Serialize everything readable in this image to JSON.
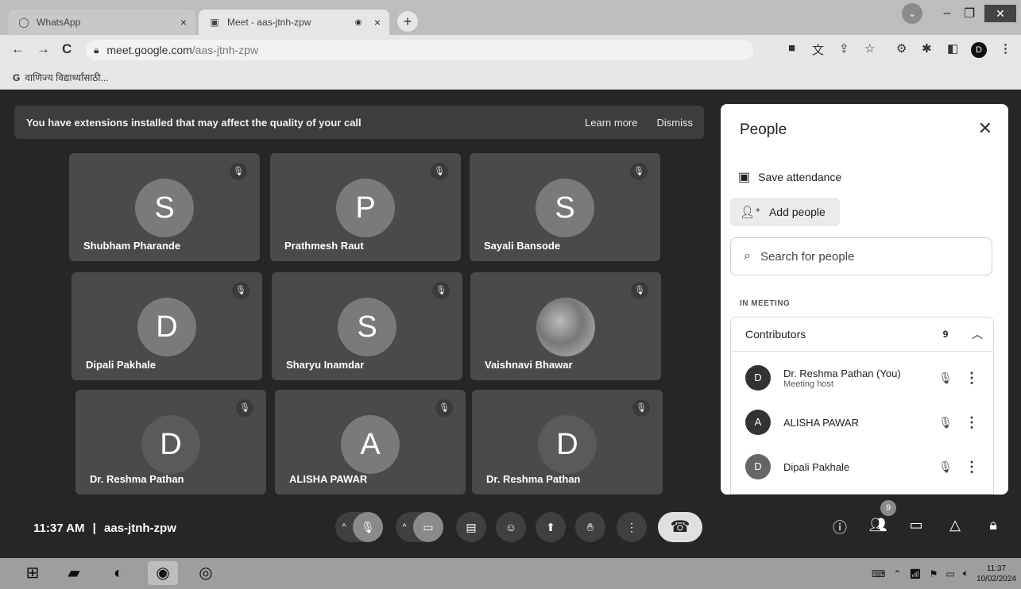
{
  "browser": {
    "tabs": [
      {
        "title": "WhatsApp",
        "icon": "whatsapp-icon",
        "close": "×"
      },
      {
        "title": "Meet - aas-jtnh-zpw",
        "icon": "meet-icon",
        "close": "×",
        "active": true
      }
    ],
    "new_tab": "+",
    "nav": {
      "back": "←",
      "forward": "→",
      "reload": "C"
    },
    "url_host": "meet.google.com",
    "url_path": "/aas-jtnh-zpw",
    "bookmark": "वाणिज्य विद्यार्थ्यांसाठी...",
    "bookmark_icon": "G"
  },
  "banner": {
    "message": "You have extensions installed that may affect the quality of your call",
    "learn_more": "Learn more",
    "dismiss": "Dismiss"
  },
  "tiles": [
    {
      "initial": "S",
      "name": "Shubham Pharande"
    },
    {
      "initial": "P",
      "name": "Prathmesh Raut"
    },
    {
      "initial": "S",
      "name": "Sayali Bansode"
    },
    {
      "initial": "D",
      "name": "Dipali Pakhale"
    },
    {
      "initial": "S",
      "name": "Sharyu Inamdar"
    },
    {
      "initial": "",
      "name": "Vaishnavi Bhawar"
    },
    {
      "initial": "D",
      "name": "Dr. Reshma Pathan"
    },
    {
      "initial": "A",
      "name": "ALISHA PAWAR"
    },
    {
      "initial": "D",
      "name": "Dr. Reshma Pathan"
    }
  ],
  "people": {
    "title": "People",
    "close": "✕",
    "save_attendance": "Save attendance",
    "add_people": "Add people",
    "search_placeholder": "Search for people",
    "section": "IN MEETING",
    "group": "Contributors",
    "count": "9",
    "members": [
      {
        "initial": "D",
        "name": "Dr. Reshma Pathan (You)",
        "role": "Meeting host"
      },
      {
        "initial": "A",
        "name": "ALISHA PAWAR",
        "role": ""
      },
      {
        "initial": "D",
        "name": "Dipali Pakhale",
        "role": ""
      }
    ]
  },
  "footer": {
    "time": "11:37 AM",
    "separator": "|",
    "meeting_code": "aas-jtnh-zpw",
    "participant_badge": "9"
  },
  "taskbar": {
    "clock_time": "11:37",
    "clock_date": "10/02/2024"
  }
}
